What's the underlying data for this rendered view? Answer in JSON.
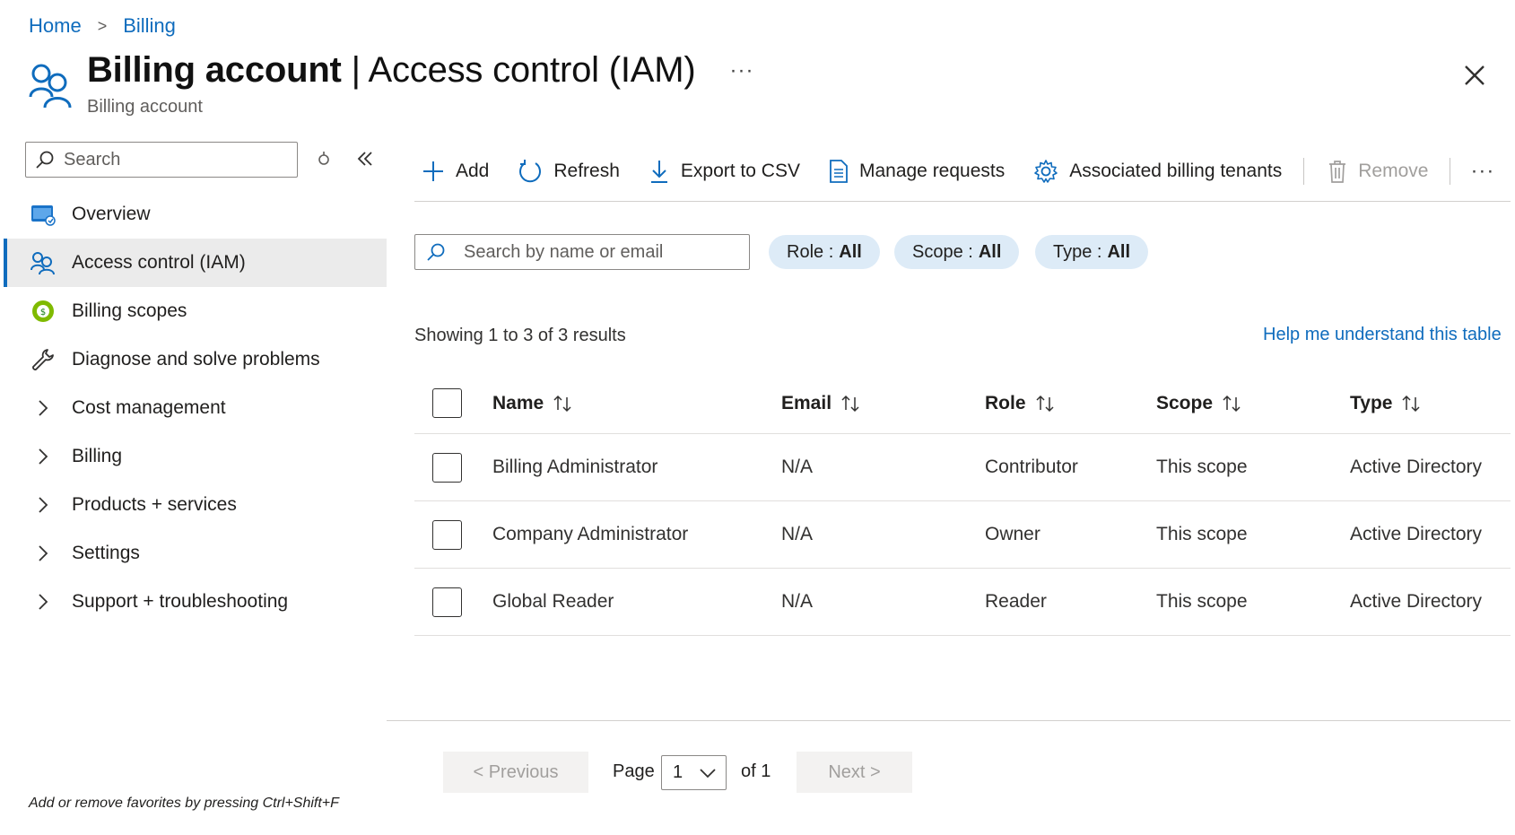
{
  "breadcrumb": {
    "home": "Home",
    "separator": ">",
    "billing": "Billing"
  },
  "header": {
    "title_bold": "Billing account",
    "title_rest": " | Access control (IAM)",
    "subtitle": "Billing account",
    "more": "···"
  },
  "sidebar": {
    "search_placeholder": "Search",
    "items": [
      {
        "label": "Overview",
        "icon": "overview-icon"
      },
      {
        "label": "Access control (IAM)",
        "icon": "people-icon",
        "active": true
      },
      {
        "label": "Billing scopes",
        "icon": "billing-scopes-icon"
      },
      {
        "label": "Diagnose and solve problems",
        "icon": "wrench-icon"
      },
      {
        "label": "Cost management",
        "icon": "chevron-right-icon"
      },
      {
        "label": "Billing",
        "icon": "chevron-right-icon"
      },
      {
        "label": "Products + services",
        "icon": "chevron-right-icon"
      },
      {
        "label": "Settings",
        "icon": "chevron-right-icon"
      },
      {
        "label": "Support + troubleshooting",
        "icon": "chevron-right-icon"
      }
    ],
    "favorites_hint": "Add or remove favorites by pressing Ctrl+Shift+F"
  },
  "toolbar": {
    "add": "Add",
    "refresh": "Refresh",
    "export": "Export to CSV",
    "manage": "Manage requests",
    "tenants": "Associated billing tenants",
    "remove": "Remove",
    "more": "···"
  },
  "filters": {
    "search_placeholder": "Search by name or email",
    "role_label": "Role :",
    "role_value": "All",
    "scope_label": "Scope :",
    "scope_value": "All",
    "type_label": "Type :",
    "type_value": "All"
  },
  "results": {
    "showing": "Showing 1 to 3 of 3 results",
    "help": "Help me understand this table"
  },
  "table": {
    "columns": [
      "Name",
      "Email",
      "Role",
      "Scope",
      "Type"
    ],
    "rows": [
      {
        "name": "Billing Administrator",
        "email": "N/A",
        "role": "Contributor",
        "scope": "This scope",
        "type": "Active Directory"
      },
      {
        "name": "Company Administrator",
        "email": "N/A",
        "role": "Owner",
        "scope": "This scope",
        "type": "Active Directory"
      },
      {
        "name": "Global Reader",
        "email": "N/A",
        "role": "Reader",
        "scope": "This scope",
        "type": "Active Directory"
      }
    ]
  },
  "pagination": {
    "previous": "< Previous",
    "page_label": "Page",
    "page_value": "1",
    "of_label": "of 1",
    "next": "Next >"
  },
  "colors": {
    "accent": "#0f6cbd",
    "pill_bg": "#ddebf7",
    "active_bg": "#ebebeb"
  }
}
